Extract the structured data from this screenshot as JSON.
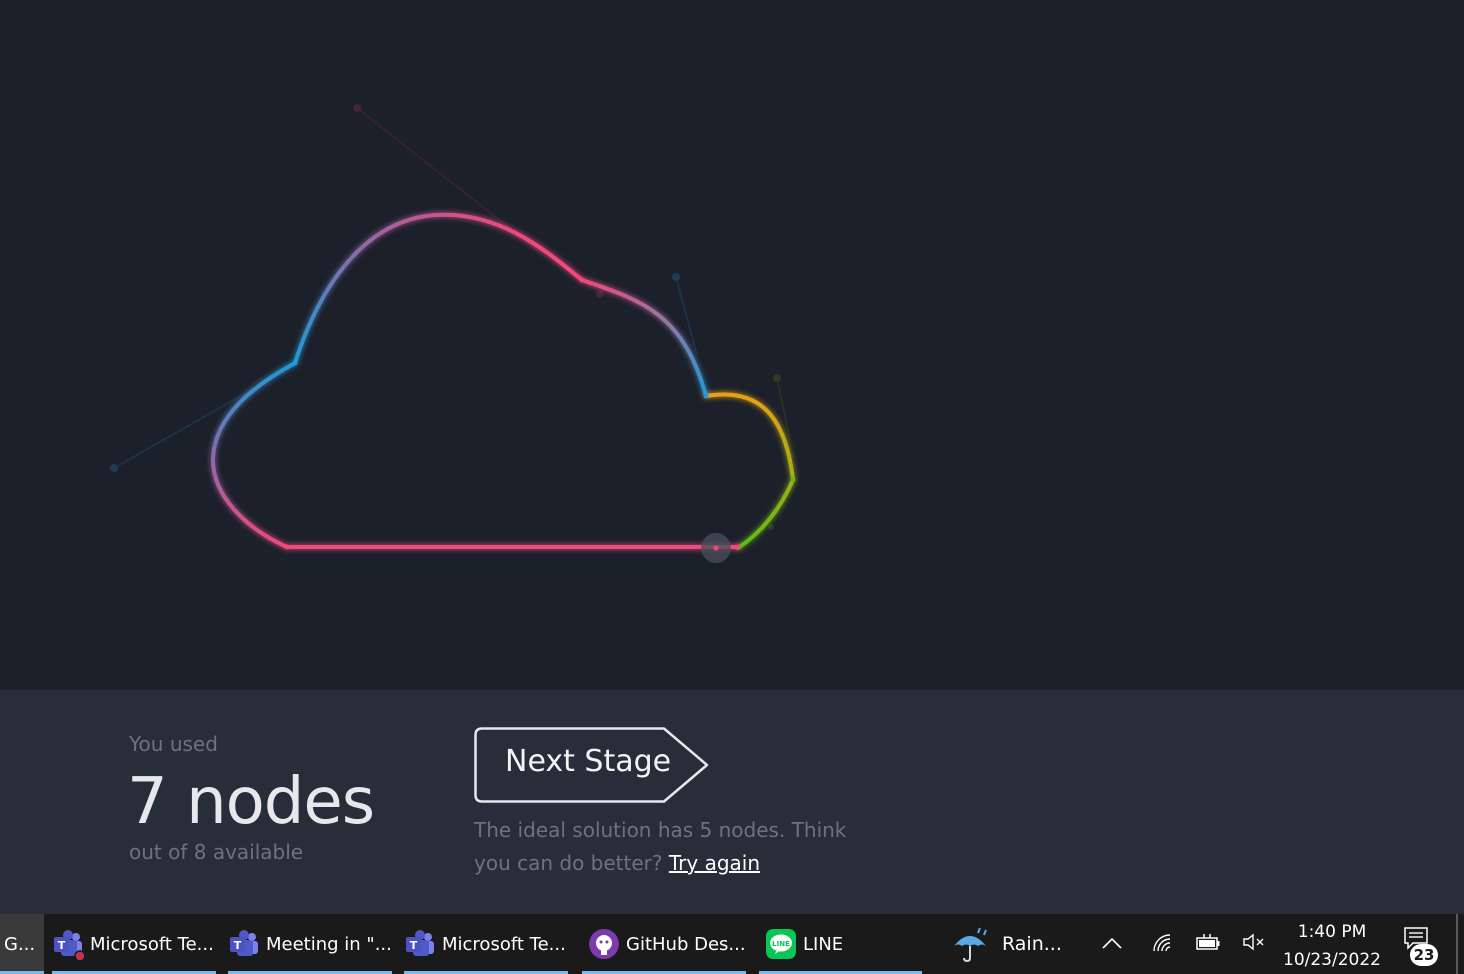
{
  "stats": {
    "used_label": "You used",
    "nodes_used": "7 nodes",
    "available": "out of 8 available"
  },
  "next_stage": {
    "label": "Next Stage"
  },
  "hint": {
    "text": "The ideal solution has 5 nodes. Think you can do better?",
    "try_again": "Try again"
  },
  "colors": {
    "canvas_bg": "#1c202b",
    "panel_bg": "#282d3a",
    "pink": "#f0487a",
    "blue": "#1e9ad6",
    "purple": "#7d6fb0",
    "orange": "#e9a012",
    "green": "#5dbb14"
  },
  "taskbar": {
    "first_app": "G...",
    "apps": [
      {
        "label": "Microsoft Te...",
        "icon": "teams-icon"
      },
      {
        "label": "Meeting in \"...",
        "icon": "teams-icon"
      },
      {
        "label": "Microsoft Te...",
        "icon": "teams-icon"
      },
      {
        "label": "GitHub Des...",
        "icon": "github-icon"
      },
      {
        "label": "LINE",
        "icon": "line-icon"
      }
    ],
    "weather": "Rain...",
    "time": "1:40 PM",
    "date": "10/23/2022",
    "notifications": "23"
  }
}
